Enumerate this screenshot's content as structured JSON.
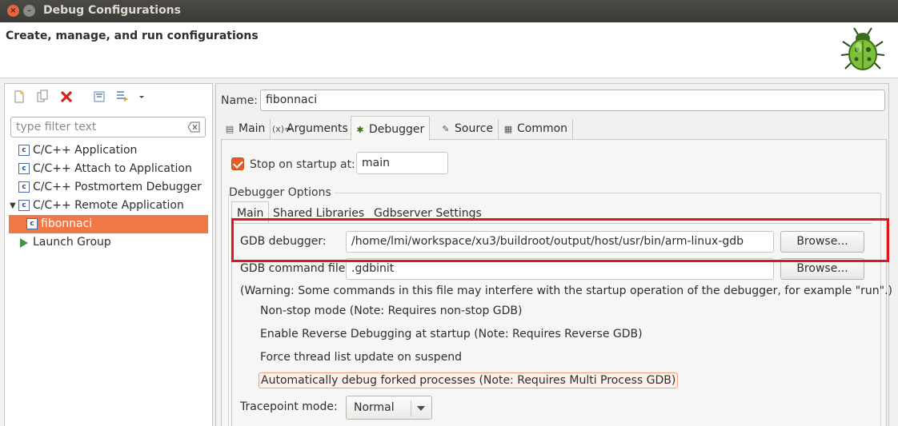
{
  "window": {
    "title": "Debug Configurations"
  },
  "header": {
    "title": "Create, manage, and run configurations"
  },
  "sidebar": {
    "filter_placeholder": "type filter text",
    "items": [
      {
        "label": "C/C++ Application"
      },
      {
        "label": "C/C++ Attach to Application"
      },
      {
        "label": "C/C++ Postmortem Debugger"
      },
      {
        "label": "C/C++ Remote Application"
      },
      {
        "label": "fibonnaci"
      },
      {
        "label": "Launch Group"
      }
    ]
  },
  "config": {
    "name_label": "Name:",
    "name_value": "fibonnaci",
    "tabs": [
      {
        "label": "Main",
        "icon": "document-icon"
      },
      {
        "label": "Arguments",
        "icon": "arguments-icon"
      },
      {
        "label": "Debugger",
        "icon": "bug-icon"
      },
      {
        "label": "Source",
        "icon": "source-icon"
      },
      {
        "label": "Common",
        "icon": "common-icon"
      }
    ],
    "active_tab": "Debugger"
  },
  "debugger": {
    "stop_on_startup_label": "Stop on startup at:",
    "stop_on_startup_checked": true,
    "stop_on_startup_value": "main",
    "options_title": "Debugger Options",
    "subtabs": [
      {
        "label": "Main"
      },
      {
        "label": "Shared Libraries"
      },
      {
        "label": "Gdbserver Settings"
      }
    ],
    "gdb_debugger_label": "GDB debugger:",
    "gdb_debugger_value": "/home/lmi/workspace/xu3/buildroot/output/host/usr/bin/arm-linux-gdb",
    "browse_label": "Browse...",
    "gdb_command_file_label": "GDB command file:",
    "gdb_command_file_value": ".gdbinit",
    "warning": "(Warning: Some commands in this file may interfere with the startup operation of the debugger, for example \"run\".)",
    "options": [
      {
        "label": "Non-stop mode (Note: Requires non-stop GDB)"
      },
      {
        "label": "Enable Reverse Debugging at startup (Note: Requires Reverse GDB)"
      },
      {
        "label": "Force thread list update on suspend"
      },
      {
        "label": "Automatically debug forked processes (Note: Requires Multi Process GDB)"
      }
    ],
    "tracepoint_label": "Tracepoint mode:",
    "tracepoint_value": "Normal"
  },
  "colors": {
    "selection": "#f07746",
    "checkbox": "#e45c23",
    "highlight_box": "#e4141c"
  }
}
